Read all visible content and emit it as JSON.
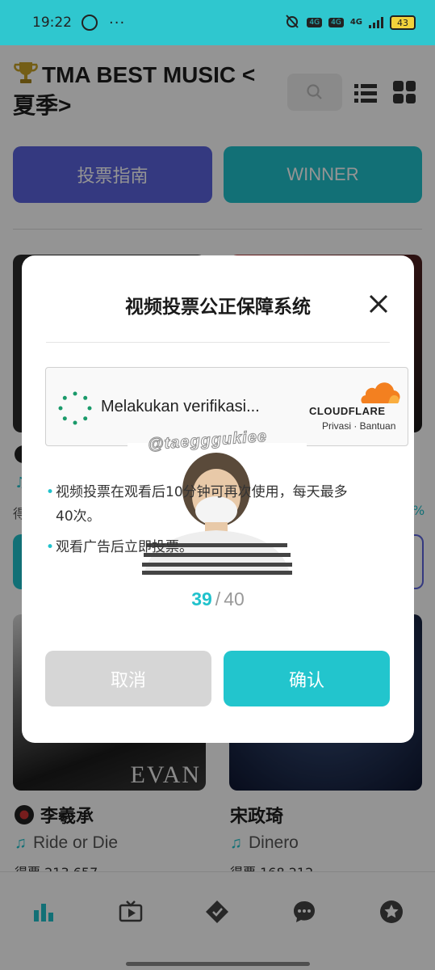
{
  "status_bar": {
    "time": "19:22",
    "dots": "···",
    "sim_badge_1": "4G",
    "sim_badge_2": "4G",
    "network": "4G",
    "battery": "43"
  },
  "header": {
    "title": "TMA BEST MUSIC < 夏季>",
    "trophy_icon": "trophy-icon",
    "search_icon": "search-icon",
    "list_icon": "list-view-icon",
    "grid_icon": "grid-view-icon"
  },
  "top_buttons": {
    "guide": "投票指南",
    "winner": "WINNER"
  },
  "cards": [
    {
      "artist": "李羲承",
      "song": "Ride or Die",
      "art_text": "EVAN",
      "votes_partial": "得票 213,657"
    },
    {
      "artist": "宋政琦",
      "song": "Dinero",
      "votes_partial": "得票 168,212"
    }
  ],
  "card_fragments": {
    "votes_prefix": "得",
    "percent": "%"
  },
  "modal": {
    "title": "视频投票公正保障系统",
    "close_icon": "close-icon",
    "cloudflare": {
      "status": "Melakukan verifikasi...",
      "brand": "CLOUDFLARE",
      "links": "Privasi · Bantuan"
    },
    "watermark": "@taegggukiee",
    "bullets": [
      "视频投票在观看后10分钟可再次使用，每天最多40次。",
      "观看广告后立即投票。"
    ],
    "count_current": "39",
    "count_sep": "/",
    "count_max": "40",
    "cancel": "取消",
    "confirm": "确认"
  },
  "bottom_nav": [
    "chart-icon",
    "video-icon",
    "vote-icon",
    "chat-icon",
    "star-icon"
  ],
  "colors": {
    "accent": "#20c2cc",
    "guide_button": "#5b63dc",
    "status_bar": "#2fc7cf"
  }
}
